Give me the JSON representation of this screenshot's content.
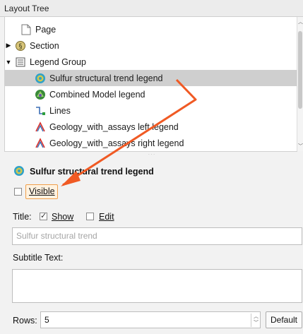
{
  "panel": {
    "title": "Layout Tree"
  },
  "tree": {
    "items": [
      {
        "label": "Page"
      },
      {
        "label": "Section"
      },
      {
        "label": "Legend Group"
      },
      {
        "label": "Sulfur structural trend legend"
      },
      {
        "label": "Combined Model legend"
      },
      {
        "label": "Lines"
      },
      {
        "label": "Geology_with_assays left legend"
      },
      {
        "label": "Geology_with_assays right legend"
      }
    ]
  },
  "properties": {
    "header": "Sulfur structural trend legend",
    "visible_label": "Visible",
    "visible_checked": false,
    "title_label": "Title:",
    "show_label": "Show",
    "show_checked": true,
    "edit_label": "Edit",
    "edit_checked": false,
    "title_value": "Sulfur structural trend",
    "subtitle_label": "Subtitle Text:",
    "subtitle_value": "",
    "rows_label": "Rows:",
    "rows_value": "5",
    "default_button": "Default"
  },
  "colors": {
    "annotation_arrow": "#f05a24",
    "selected_row": "#cfcfcf"
  }
}
